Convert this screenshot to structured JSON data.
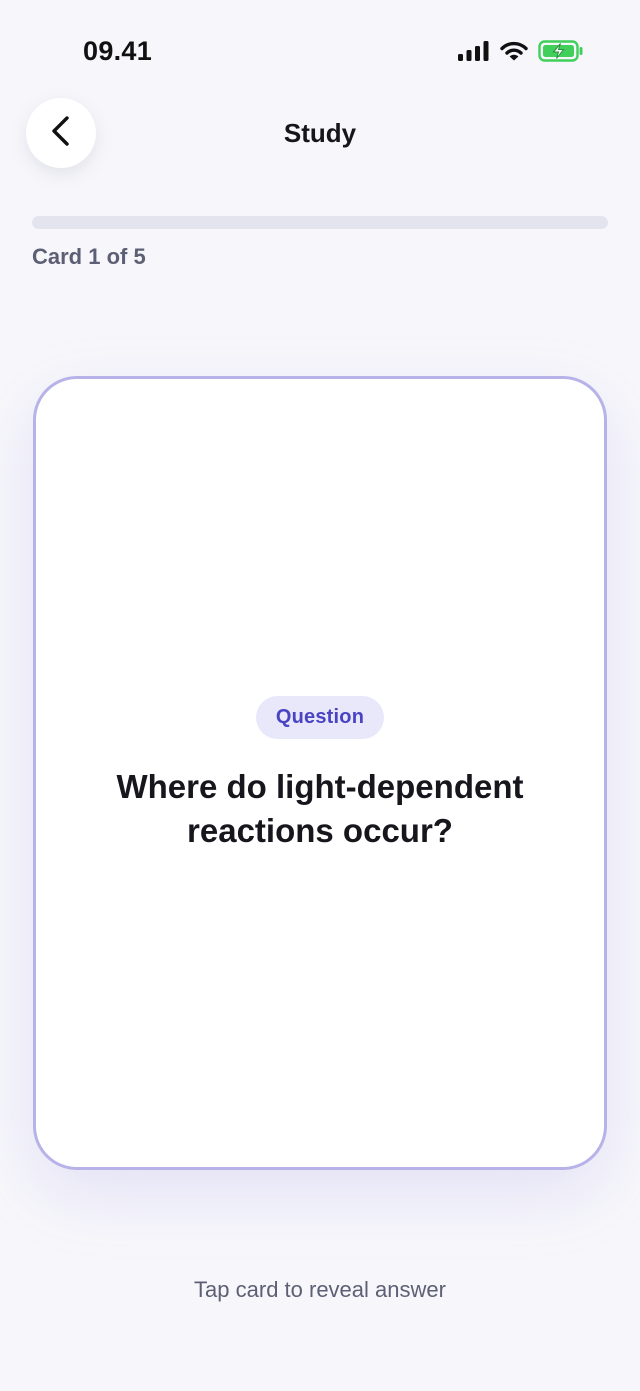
{
  "status_bar": {
    "time": "09.41",
    "icons": [
      "signal-icon",
      "wifi-icon",
      "battery-charging-icon"
    ],
    "battery_color": "#3fcf5a"
  },
  "header": {
    "back_icon": "chevron-left-icon",
    "title": "Study"
  },
  "progress": {
    "current": 1,
    "total": 5,
    "label": "Card 1 of 5"
  },
  "card": {
    "badge": "Question",
    "text": "Where do light-dependent reactions occur?",
    "border_color": "#b7b3e8",
    "badge_color": "#4b44c2"
  },
  "hint": "Tap card to reveal answer"
}
